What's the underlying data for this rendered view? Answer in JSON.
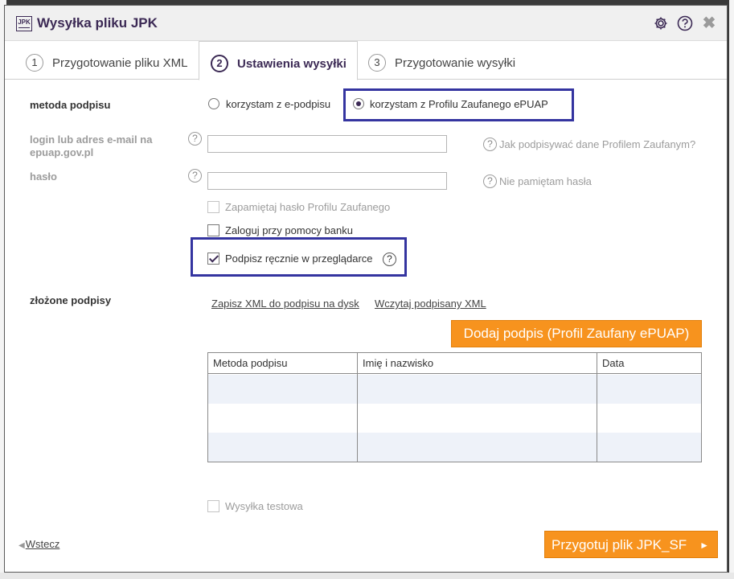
{
  "window": {
    "app_logo": "JPK",
    "title": "Wysyłka pliku JPK",
    "icons": [
      "gear-icon",
      "help-icon",
      "close-icon"
    ],
    "close_glyph": "✖"
  },
  "tabs": [
    {
      "num": "1",
      "label": "Przygotowanie pliku XML",
      "active": false
    },
    {
      "num": "2",
      "label": "Ustawienia wysyłki",
      "active": true
    },
    {
      "num": "3",
      "label": "Przygotowanie wysyłki",
      "active": false
    }
  ],
  "form": {
    "signature_method": {
      "label": "metoda podpisu",
      "options": [
        {
          "label": "korzystam z e-podpisu",
          "selected": false
        },
        {
          "label": "korzystam z Profilu Zaufanego ePUAP",
          "selected": true
        }
      ]
    },
    "login": {
      "label_line1": "login lub adres e-mail na",
      "label_line2": "epuap.gov.pl",
      "value": "",
      "help_text": "Jak podpisywać dane Profilem Zaufanym?"
    },
    "password": {
      "label": "hasło",
      "value": "",
      "help_text": "Nie pamiętam hasła"
    },
    "remember_password": {
      "label": "Zapamiętaj hasło Profilu Zaufanego",
      "checked": false,
      "disabled": true
    },
    "bank_login": {
      "label": "Zaloguj przy pomocy banku",
      "checked": false,
      "disabled": false
    },
    "sign_in_browser": {
      "label": "Podpisz ręcznie w przeglądarce",
      "checked": true,
      "disabled": false
    },
    "signatures": {
      "label": "złożone podpisy",
      "save_link": "Zapisz XML do podpisu na dysk",
      "load_link": "Wczytaj podpisany XML",
      "add_button": "Dodaj podpis (Profil Zaufany ePUAP)",
      "columns": [
        "Metoda podpisu",
        "Imię i nazwisko",
        "Data"
      ],
      "rows": []
    },
    "test_send": {
      "label": "Wysyłka testowa",
      "checked": false,
      "disabled": true
    }
  },
  "footer": {
    "back_label": "Wstecz",
    "next_label": "Przygotuj plik JPK_SF",
    "next_arrow": "►"
  },
  "colors": {
    "accent": "#3c2a55",
    "highlight_box": "#3434a0",
    "button_orange": "#f7931e",
    "table_alt_row": "#eef2f9"
  }
}
